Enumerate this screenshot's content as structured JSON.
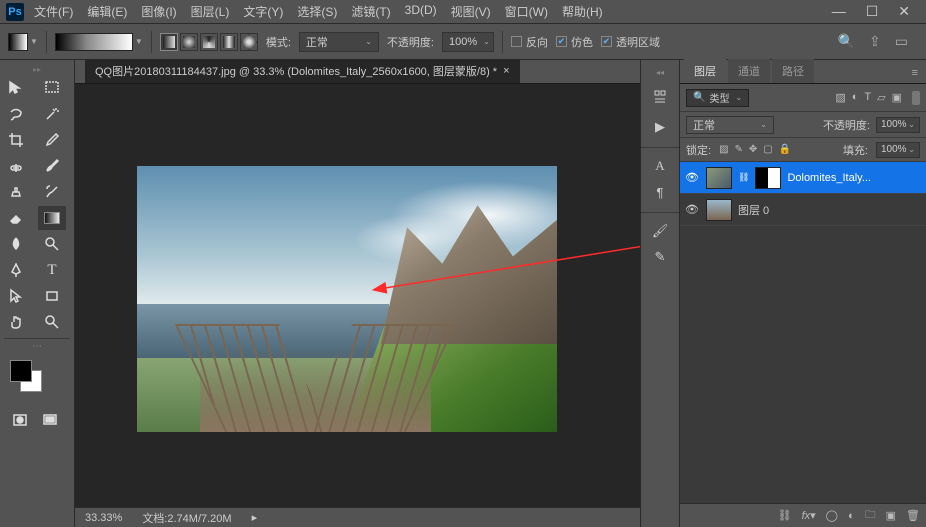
{
  "app": {
    "logo": "Ps"
  },
  "menu": [
    "文件(F)",
    "编辑(E)",
    "图像(I)",
    "图层(L)",
    "文字(Y)",
    "选择(S)",
    "滤镜(T)",
    "3D(D)",
    "视图(V)",
    "窗口(W)",
    "帮助(H)"
  ],
  "optbar": {
    "mode_label": "模式:",
    "mode_value": "正常",
    "opacity_label": "不透明度:",
    "opacity_value": "100%",
    "chk_reverse": "反向",
    "chk_dither": "仿色",
    "chk_trans": "透明区域"
  },
  "document": {
    "tab_title": "QQ图片20180311184437.jpg @ 33.3% (Dolomites_Italy_2560x1600, 图层蒙版/8) *",
    "zoom": "33.33%",
    "status_label": "文档:",
    "status_value": "2.74M/7.20M"
  },
  "panels": {
    "tabs": [
      "图层",
      "通道",
      "路径"
    ],
    "filter_label": "类型",
    "blend_mode": "正常",
    "opacity_label": "不透明度:",
    "opacity_value": "100%",
    "lock_label": "锁定:",
    "fill_label": "填充:",
    "fill_value": "100%",
    "layers": [
      {
        "name": "Dolomites_Italy...",
        "has_mask": true,
        "selected": true
      },
      {
        "name": "图层 0",
        "has_mask": false,
        "selected": false
      }
    ]
  }
}
